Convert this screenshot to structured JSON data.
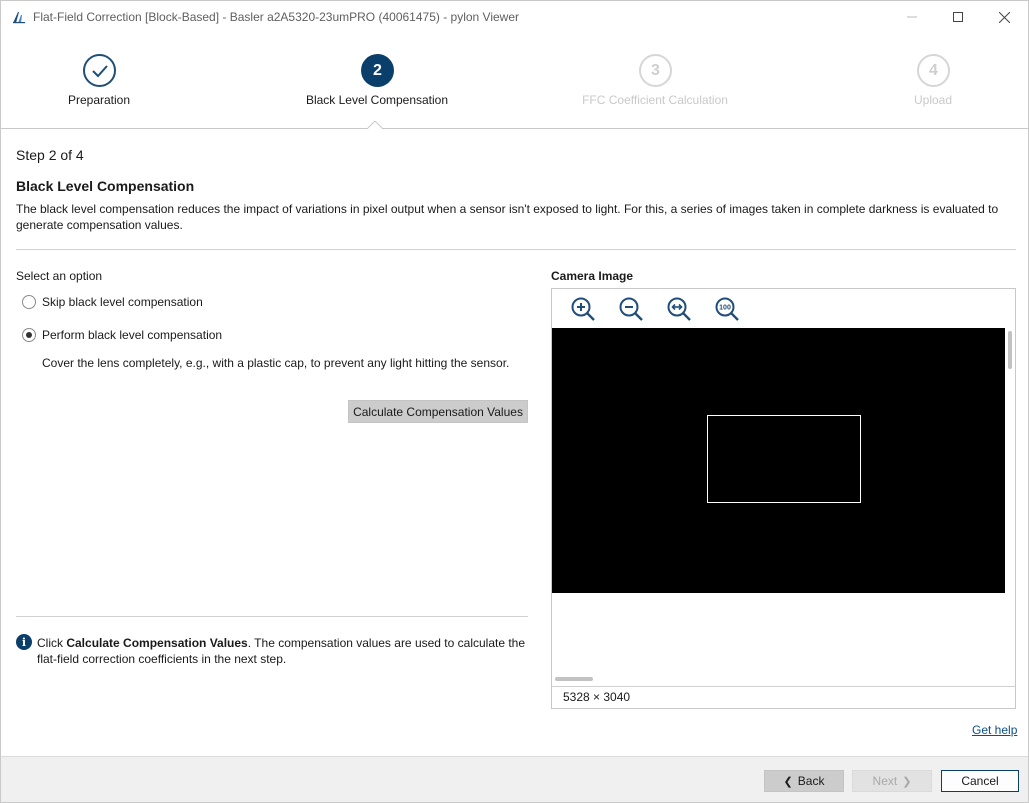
{
  "window": {
    "title": "Flat-Field Correction [Block-Based] - Basler a2A5320-23umPRO (40061475) - pylon Viewer"
  },
  "stepper": {
    "steps": [
      {
        "number": "✓",
        "label": "Preparation",
        "state": "done"
      },
      {
        "number": "2",
        "label": "Black Level Compensation",
        "state": "active"
      },
      {
        "number": "3",
        "label": "FFC Coefficient Calculation",
        "state": "future"
      },
      {
        "number": "4",
        "label": "Upload",
        "state": "future"
      }
    ]
  },
  "content": {
    "step_counter": "Step 2 of 4",
    "title": "Black Level Compensation",
    "description": "The black level compensation reduces the impact of variations in pixel output when a sensor isn't exposed to light. For this, a series of images taken in complete darkness is evaluated to generate compensation values.",
    "select_label": "Select an option",
    "options": [
      {
        "label": "Skip black level compensation",
        "checked": false
      },
      {
        "label": "Perform black level compensation",
        "checked": true
      }
    ],
    "instruction": "Cover the lens completely, e.g., with a plastic cap, to prevent any light hitting the sensor.",
    "calc_button": "Calculate Compensation Values",
    "info": {
      "prefix": "Click ",
      "bold": "Calculate Compensation Values",
      "suffix": ". The compensation values are used to calculate the flat-field correction coefficients in the next step."
    }
  },
  "camera": {
    "title": "Camera Image",
    "toolbar": [
      "zoom-in-icon",
      "zoom-out-icon",
      "zoom-fit-icon",
      "zoom-100-icon"
    ],
    "zoom_100_text": "100",
    "resolution": "5328 × 3040"
  },
  "help_link": "Get help",
  "footer": {
    "back": "Back",
    "next": "Next",
    "cancel": "Cancel"
  },
  "colors": {
    "accent": "#0b3f6b",
    "link": "#0b4f8a",
    "image_bg": "#000000"
  }
}
